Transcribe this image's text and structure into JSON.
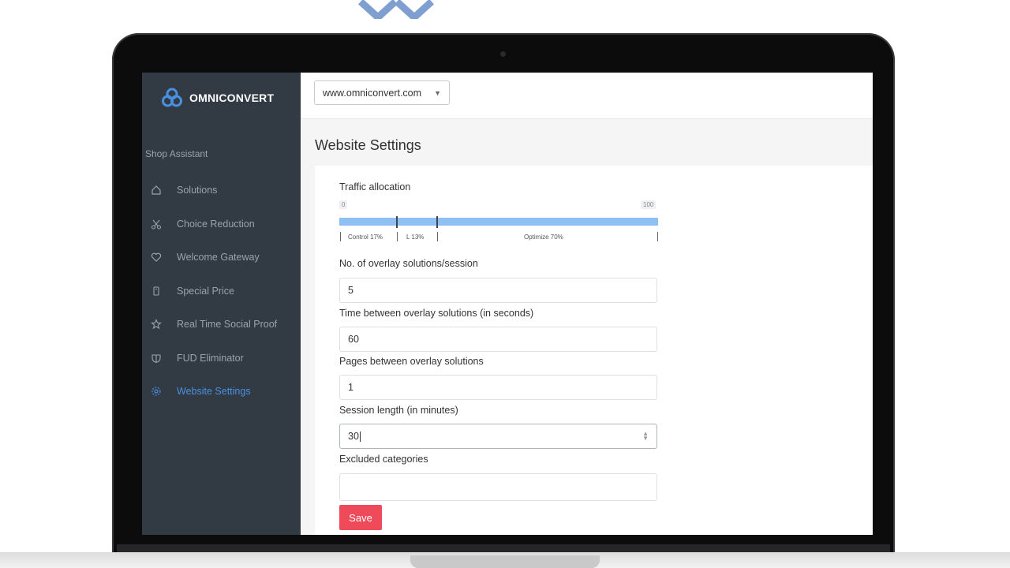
{
  "brand": {
    "name": "OMNICONVERT",
    "accent": "#4a90e2"
  },
  "sidebar": {
    "section_label": "Shop Assistant",
    "items": [
      {
        "label": "Solutions",
        "icon": "home-icon",
        "active": false
      },
      {
        "label": "Choice Reduction",
        "icon": "scissors-icon",
        "active": false
      },
      {
        "label": "Welcome Gateway",
        "icon": "heart-icon",
        "active": false
      },
      {
        "label": "Special Price",
        "icon": "tag-icon",
        "active": false
      },
      {
        "label": "Real Time Social Proof",
        "icon": "star-icon",
        "active": false
      },
      {
        "label": "FUD Eliminator",
        "icon": "shield-icon",
        "active": false
      },
      {
        "label": "Website Settings",
        "icon": "gear-icon",
        "active": true
      }
    ]
  },
  "topbar": {
    "site_select": "www.omniconvert.com"
  },
  "page": {
    "title": "Website Settings"
  },
  "traffic": {
    "label": "Traffic allocation",
    "min": "0",
    "max": "100",
    "segments": [
      {
        "label": "Control 17%",
        "percent": 17
      },
      {
        "label": "L 13%",
        "percent": 13
      },
      {
        "label": "Optimize 70%",
        "percent": 70
      }
    ]
  },
  "fields": {
    "overlay_solutions": {
      "label": "No. of overlay solutions/session",
      "value": "5"
    },
    "time_between": {
      "label": "Time between overlay solutions (in seconds)",
      "value": "60"
    },
    "pages_between": {
      "label": "Pages between overlay solutions",
      "value": "1"
    },
    "session_length": {
      "label": "Session length (in minutes)",
      "value": "30"
    },
    "excluded_categories": {
      "label": "Excluded categories",
      "value": ""
    }
  },
  "actions": {
    "save_label": "Save",
    "save_color": "#ee4a59"
  }
}
